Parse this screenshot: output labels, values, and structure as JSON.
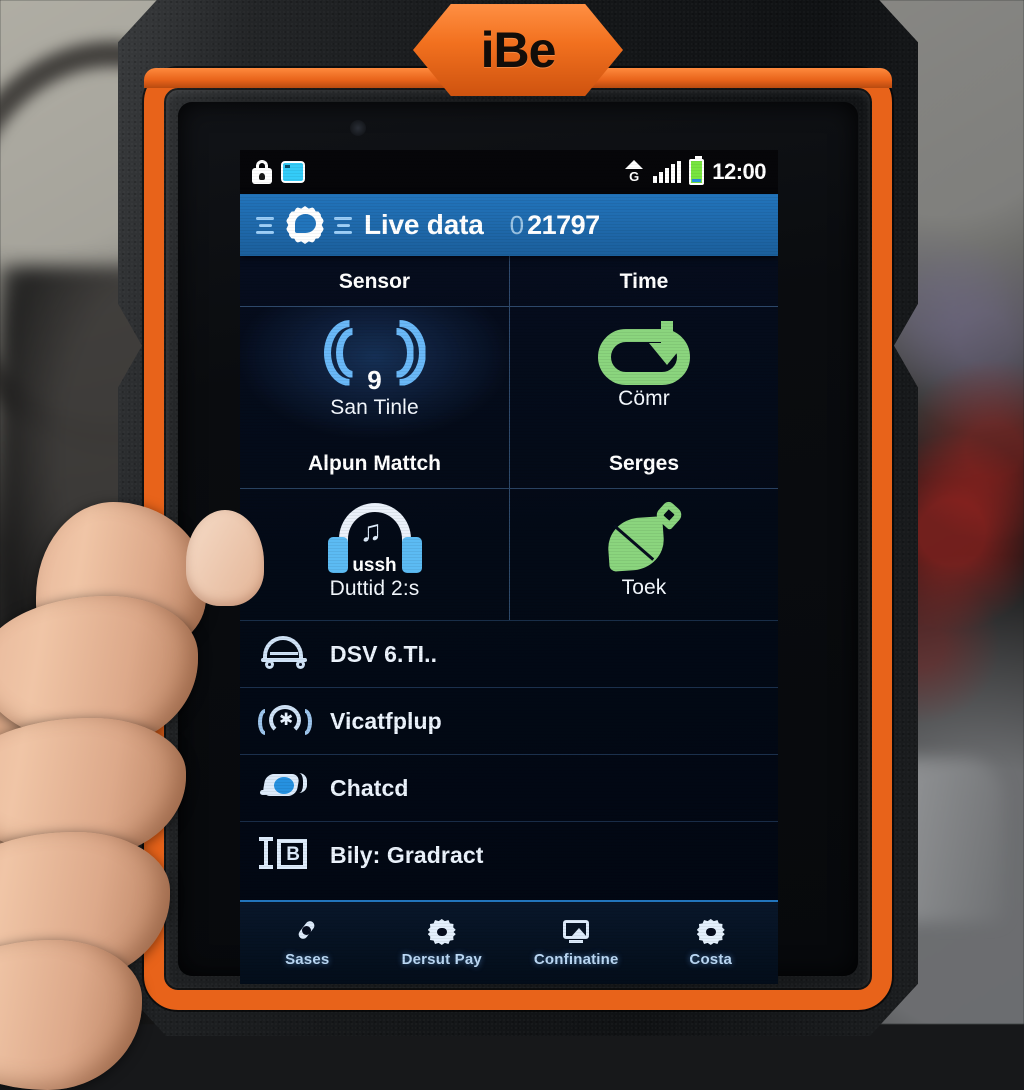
{
  "device": {
    "brand_badge": "iBe",
    "type": "rugged automotive diagnostic tablet"
  },
  "statusbar": {
    "left_icons": [
      "lock-bag-icon",
      "screenshot-icon"
    ],
    "right_icons": [
      "g-network-icon",
      "signal-bars-icon",
      "battery-icon"
    ],
    "clock": "12:00"
  },
  "titlebar": {
    "logo": "gear-speech-logo",
    "title": "Live data",
    "code_prefix": "0",
    "code": "21797"
  },
  "grid": {
    "headers_row1": [
      "Sensor",
      "Time"
    ],
    "headers_row2": [
      "Alpun Mattch",
      "Serges"
    ],
    "cells_row1": [
      {
        "icon": "wifi-sensor-icon",
        "badge": "9",
        "label": "San Tinle",
        "selected": true
      },
      {
        "icon": "loop-arrow-icon",
        "badge": "",
        "label": "Cömr",
        "selected": false
      }
    ],
    "cells_row2": [
      {
        "icon": "headphones-icon",
        "badge": "ussh",
        "label": "Duttid 2:s",
        "selected": false
      },
      {
        "icon": "leaf-trowel-icon",
        "badge": "",
        "label": "Toek",
        "selected": false
      }
    ]
  },
  "list": {
    "rows": [
      {
        "icon": "car-icon",
        "label": "DSV 6.TI.."
      },
      {
        "icon": "gauge-icon",
        "label": "Vicatfplup"
      },
      {
        "icon": "chat-icon",
        "label": "Chatcd"
      },
      {
        "icon": "billboard-icon",
        "label": "Bily: Gradract"
      }
    ]
  },
  "navbar": {
    "items": [
      {
        "icon": "phone-icon",
        "label": "Sases"
      },
      {
        "icon": "gear-icon",
        "label": "Dersut Pay"
      },
      {
        "icon": "screen-icon",
        "label": "Confinatine"
      },
      {
        "icon": "gear-icon",
        "label": "Costa"
      }
    ]
  },
  "colors": {
    "frame_orange": "#e8631a",
    "title_blue": "#2a74b4",
    "accent_blue": "#6fb6ef",
    "accent_green": "#8ed183",
    "battery_green": "#7ee04b"
  }
}
